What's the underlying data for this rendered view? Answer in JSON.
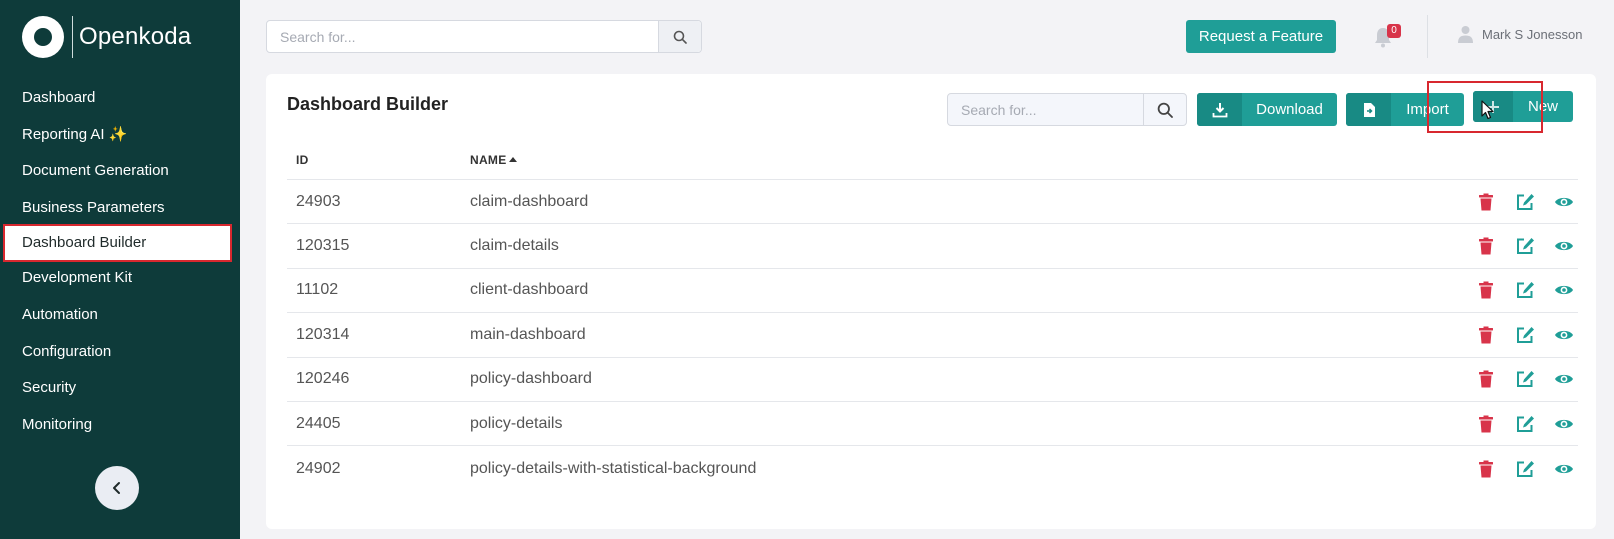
{
  "brand": {
    "name": "Openkoda"
  },
  "sidebar": {
    "items": [
      {
        "label": "Dashboard"
      },
      {
        "label": "Reporting AI ✨"
      },
      {
        "label": "Document Generation"
      },
      {
        "label": "Business Parameters"
      },
      {
        "label": "Dashboard Builder",
        "active": true
      },
      {
        "label": "Development Kit"
      },
      {
        "label": "Automation"
      },
      {
        "label": "Configuration"
      },
      {
        "label": "Security"
      },
      {
        "label": "Monitoring"
      }
    ]
  },
  "topbar": {
    "search_placeholder": "Search for...",
    "feature_label": "Request a Feature",
    "notifications_count": "0",
    "user_name": "Mark S Jonesson"
  },
  "page": {
    "title": "Dashboard Builder",
    "search_placeholder": "Search for...",
    "download_label": "Download",
    "import_label": "Import",
    "new_label": "New",
    "columns": {
      "id": "ID",
      "name": "NAME"
    },
    "rows": [
      {
        "id": "24903",
        "name": "claim-dashboard"
      },
      {
        "id": "120315",
        "name": "claim-details"
      },
      {
        "id": "11102",
        "name": "client-dashboard"
      },
      {
        "id": "120314",
        "name": "main-dashboard"
      },
      {
        "id": "120246",
        "name": "policy-dashboard"
      },
      {
        "id": "24405",
        "name": "policy-details"
      },
      {
        "id": "24902",
        "name": "policy-details-with-statistical-background"
      }
    ]
  },
  "colors": {
    "sidebar": "#0e3b3a",
    "accent": "#1f9e97",
    "danger": "#d8344a",
    "highlight": "#d8282f"
  },
  "icons": [
    "search-icon",
    "bell-icon",
    "user-icon",
    "download-icon",
    "import-icon",
    "plus-icon",
    "trash-icon",
    "edit-icon",
    "eye-icon",
    "chevron-left-icon"
  ]
}
